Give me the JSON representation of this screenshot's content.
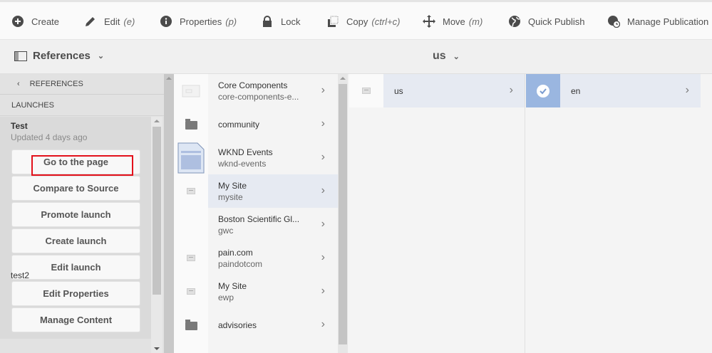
{
  "toolbar": {
    "items": [
      {
        "label": "Create",
        "shortcut": "",
        "icon": "plus-circle-icon"
      },
      {
        "label": "Edit",
        "shortcut": "(e)",
        "icon": "pencil-icon"
      },
      {
        "label": "Properties",
        "shortcut": "(p)",
        "icon": "info-icon"
      },
      {
        "label": "Lock",
        "shortcut": "",
        "icon": "lock-icon"
      },
      {
        "label": "Copy",
        "shortcut": "(ctrl+c)",
        "icon": "copy-icon"
      },
      {
        "label": "Move",
        "shortcut": "(m)",
        "icon": "move-icon"
      },
      {
        "label": "Quick Publish",
        "shortcut": "",
        "icon": "globe-icon"
      },
      {
        "label": "Manage Publication",
        "shortcut": "",
        "icon": "globe-clock-icon"
      }
    ]
  },
  "header": {
    "rail_selector": "References",
    "breadcrumb": "us"
  },
  "references": {
    "back_label": "REFERENCES",
    "section": "LAUNCHES",
    "launch": {
      "title": "Test",
      "updated": "Updated 4 days ago",
      "actions": [
        "Go to the page",
        "Compare to Source",
        "Promote launch",
        "Create launch",
        "Edit launch",
        "Edit Properties",
        "Manage Content"
      ]
    },
    "next_launch": "test2"
  },
  "columns": {
    "col1": [
      {
        "title": "Core Components",
        "name": "core-components-e...",
        "icon": "component-icon"
      },
      {
        "title": "community",
        "name": "",
        "icon": "folder-icon"
      },
      {
        "title": "WKND Events",
        "name": "wknd-events",
        "icon": "page-thumbnail-icon"
      },
      {
        "title": "My Site",
        "name": "mysite",
        "icon": "page-icon",
        "selected": true
      },
      {
        "title": "Boston Scientific Gl...",
        "name": "gwc",
        "icon": ""
      },
      {
        "title": "pain.com",
        "name": "paindotcom",
        "icon": "page-icon"
      },
      {
        "title": "My Site",
        "name": "ewp",
        "icon": "page-icon"
      },
      {
        "title": "advisories",
        "name": "",
        "icon": "folder-icon"
      }
    ],
    "col2": [
      {
        "title": "us",
        "icon": "page-icon",
        "selected": true
      }
    ],
    "col3": [
      {
        "title": "en",
        "icon": "checkmark-icon",
        "checked": true
      }
    ]
  },
  "colors": {
    "selected_row": "#e6eaf2",
    "checked": "#9ab6e0",
    "highlight_box": "#e3111b"
  }
}
